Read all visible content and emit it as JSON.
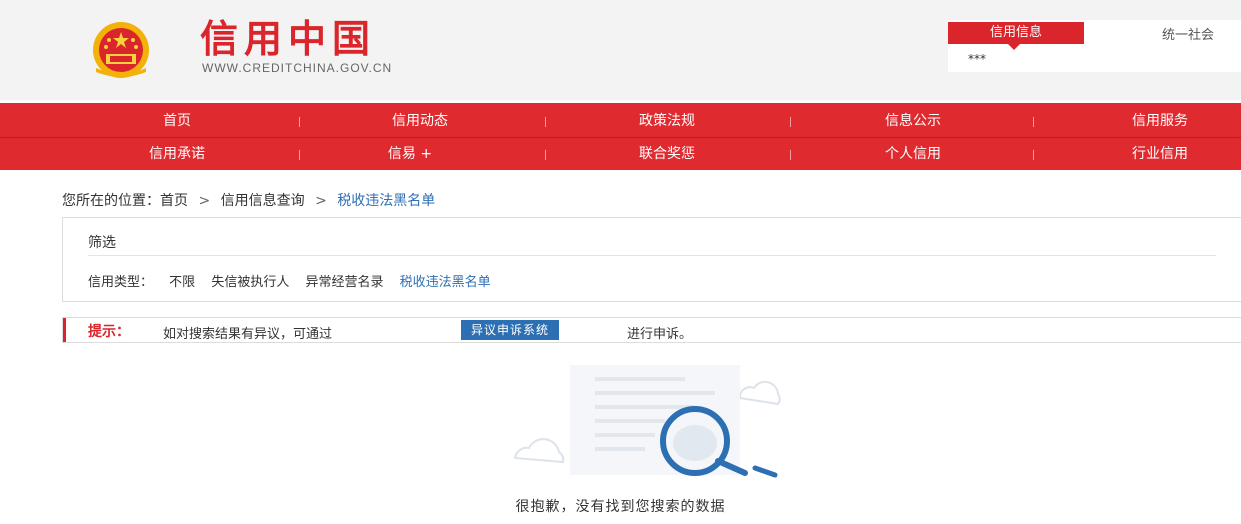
{
  "header": {
    "logo_title": "信用中国",
    "logo_subtitle": "WWW.CREDITCHINA.GOV.CN",
    "search_tab": "信用信息",
    "search_link": "统一社会",
    "search_value": "***"
  },
  "nav": {
    "row1": [
      "首页",
      "信用动态",
      "政策法规",
      "信息公示",
      "信用服务"
    ],
    "row2": [
      "信用承诺",
      "信易 +",
      "联合奖惩",
      "个人信用",
      "行业信用"
    ]
  },
  "breadcrumb": {
    "prefix": "您所在的位置：首页",
    "arrow": ">",
    "middle": "信用信息查询",
    "current": "税收违法黑名单"
  },
  "filter": {
    "title": "筛选",
    "type_label": "信用类型：",
    "options": [
      "不限",
      "失信被执行人",
      "异常经营名录",
      "税收违法黑名单"
    ],
    "active_index": 3
  },
  "tip": {
    "label": "提示：",
    "text": "如对搜索结果有异议，可通过",
    "button": "异议申诉系统",
    "text2": "进行申诉。"
  },
  "empty": {
    "message": "很抱歉，没有找到您搜索的数据"
  },
  "colors": {
    "brand_red": "#d9252b",
    "link_blue": "#2d6fb3"
  }
}
